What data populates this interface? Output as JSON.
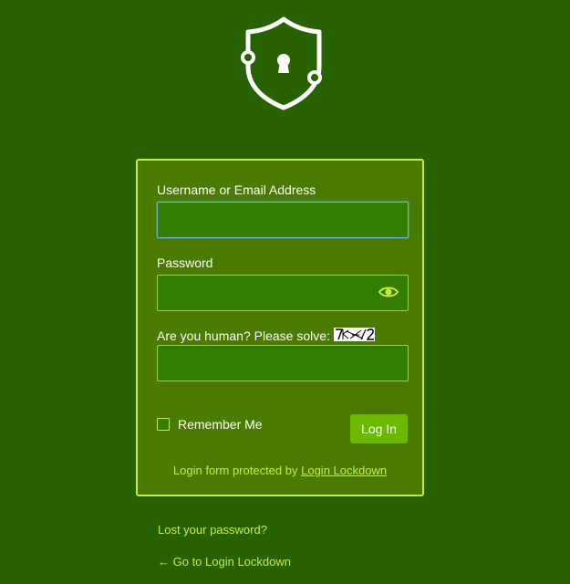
{
  "logo": {
    "icon": "shield-lock-icon"
  },
  "form": {
    "username_label": "Username or Email Address",
    "username_value": "",
    "password_label": "Password",
    "password_value": "",
    "captcha_label": "Are you human? Please solve:",
    "captcha_value": "",
    "remember_label": "Remember Me",
    "remember_checked": false,
    "login_button": "Log In"
  },
  "footer": {
    "protected_prefix": "Login form protected by ",
    "protected_link": "Login Lockdown"
  },
  "links": {
    "lost_password": "Lost your password?",
    "back_link": "← Go to Login Lockdown"
  },
  "colors": {
    "background": "#286100",
    "box": "#4a7a00",
    "accent": "#c5ec3d",
    "button": "#6bb800"
  }
}
